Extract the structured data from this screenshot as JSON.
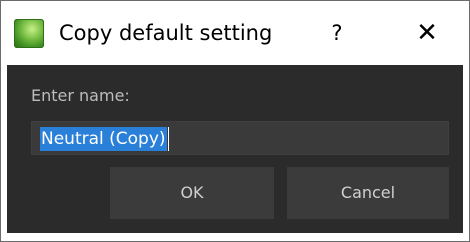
{
  "window": {
    "title": "Copy default setting",
    "help_label": "?",
    "close_label": "✕",
    "icon": "app-icon"
  },
  "form": {
    "label": "Enter name:",
    "name_value": "Neutral (Copy)"
  },
  "buttons": {
    "ok_label": "OK",
    "cancel_label": "Cancel"
  },
  "colors": {
    "body_bg": "#2b2b2b",
    "input_bg": "#3a3a3a",
    "selection": "#2a7fd9",
    "button_bg": "#3b3b3b"
  }
}
